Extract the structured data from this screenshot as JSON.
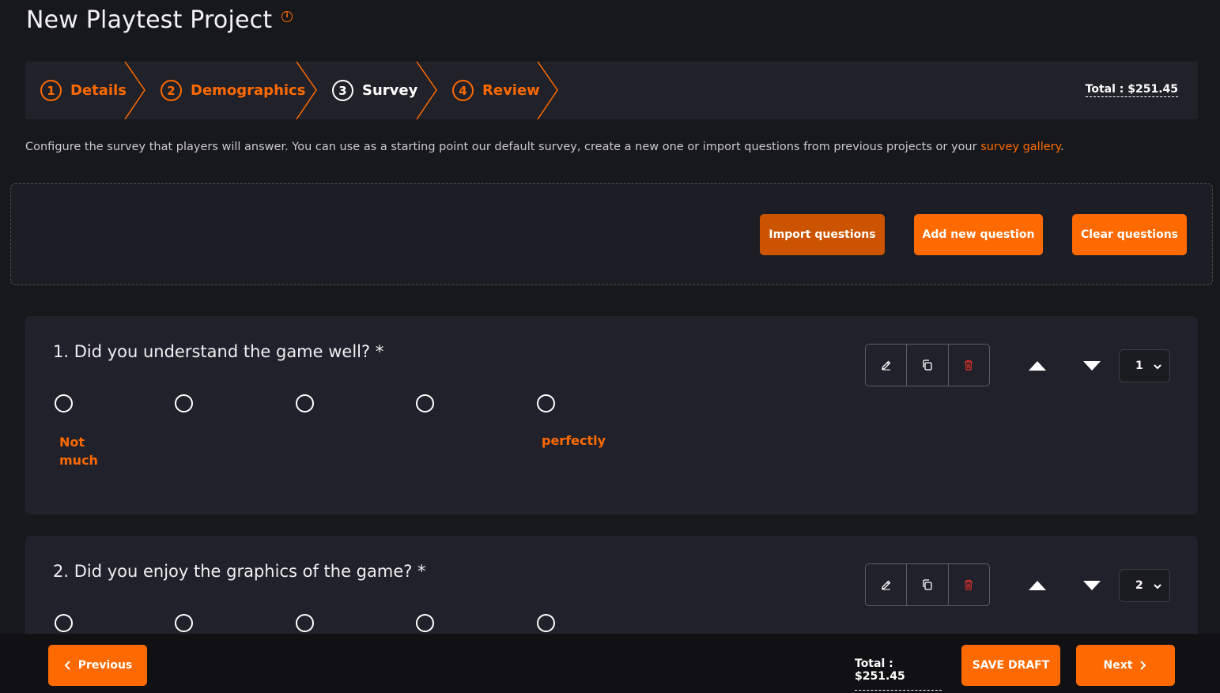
{
  "page": {
    "title": "New Playtest Project",
    "info_icon": "i"
  },
  "stepper": {
    "steps": [
      {
        "num": "1",
        "label": "Details"
      },
      {
        "num": "2",
        "label": "Demographics"
      },
      {
        "num": "3",
        "label": "Survey"
      },
      {
        "num": "4",
        "label": "Review"
      }
    ],
    "active_step": 3,
    "total": "Total : $251.45"
  },
  "intro": {
    "text": "Configure the survey that players will answer. You can use as a starting point our default survey, create a new one or import questions from previous projects or your ",
    "link": "survey gallery",
    "suffix": "."
  },
  "toolbar": {
    "import": "Import questions",
    "add": "Add new question",
    "clear": "Clear questions"
  },
  "questions": [
    {
      "title": "1.  Did you understand the game well? *",
      "low": "Not much",
      "high": "perfectly",
      "order": "1"
    },
    {
      "title": "2.  Did you enjoy the graphics of the game? *",
      "order": "2"
    }
  ],
  "footer": {
    "previous": "Previous",
    "total": "Total : $251.45",
    "save": "SAVE DRAFT",
    "next": "Next"
  },
  "colors": {
    "accent": "#ff6a00",
    "accent_dark": "#cc5400",
    "bg": "#17181c",
    "card": "#20212a",
    "delete": "#e0302a"
  }
}
